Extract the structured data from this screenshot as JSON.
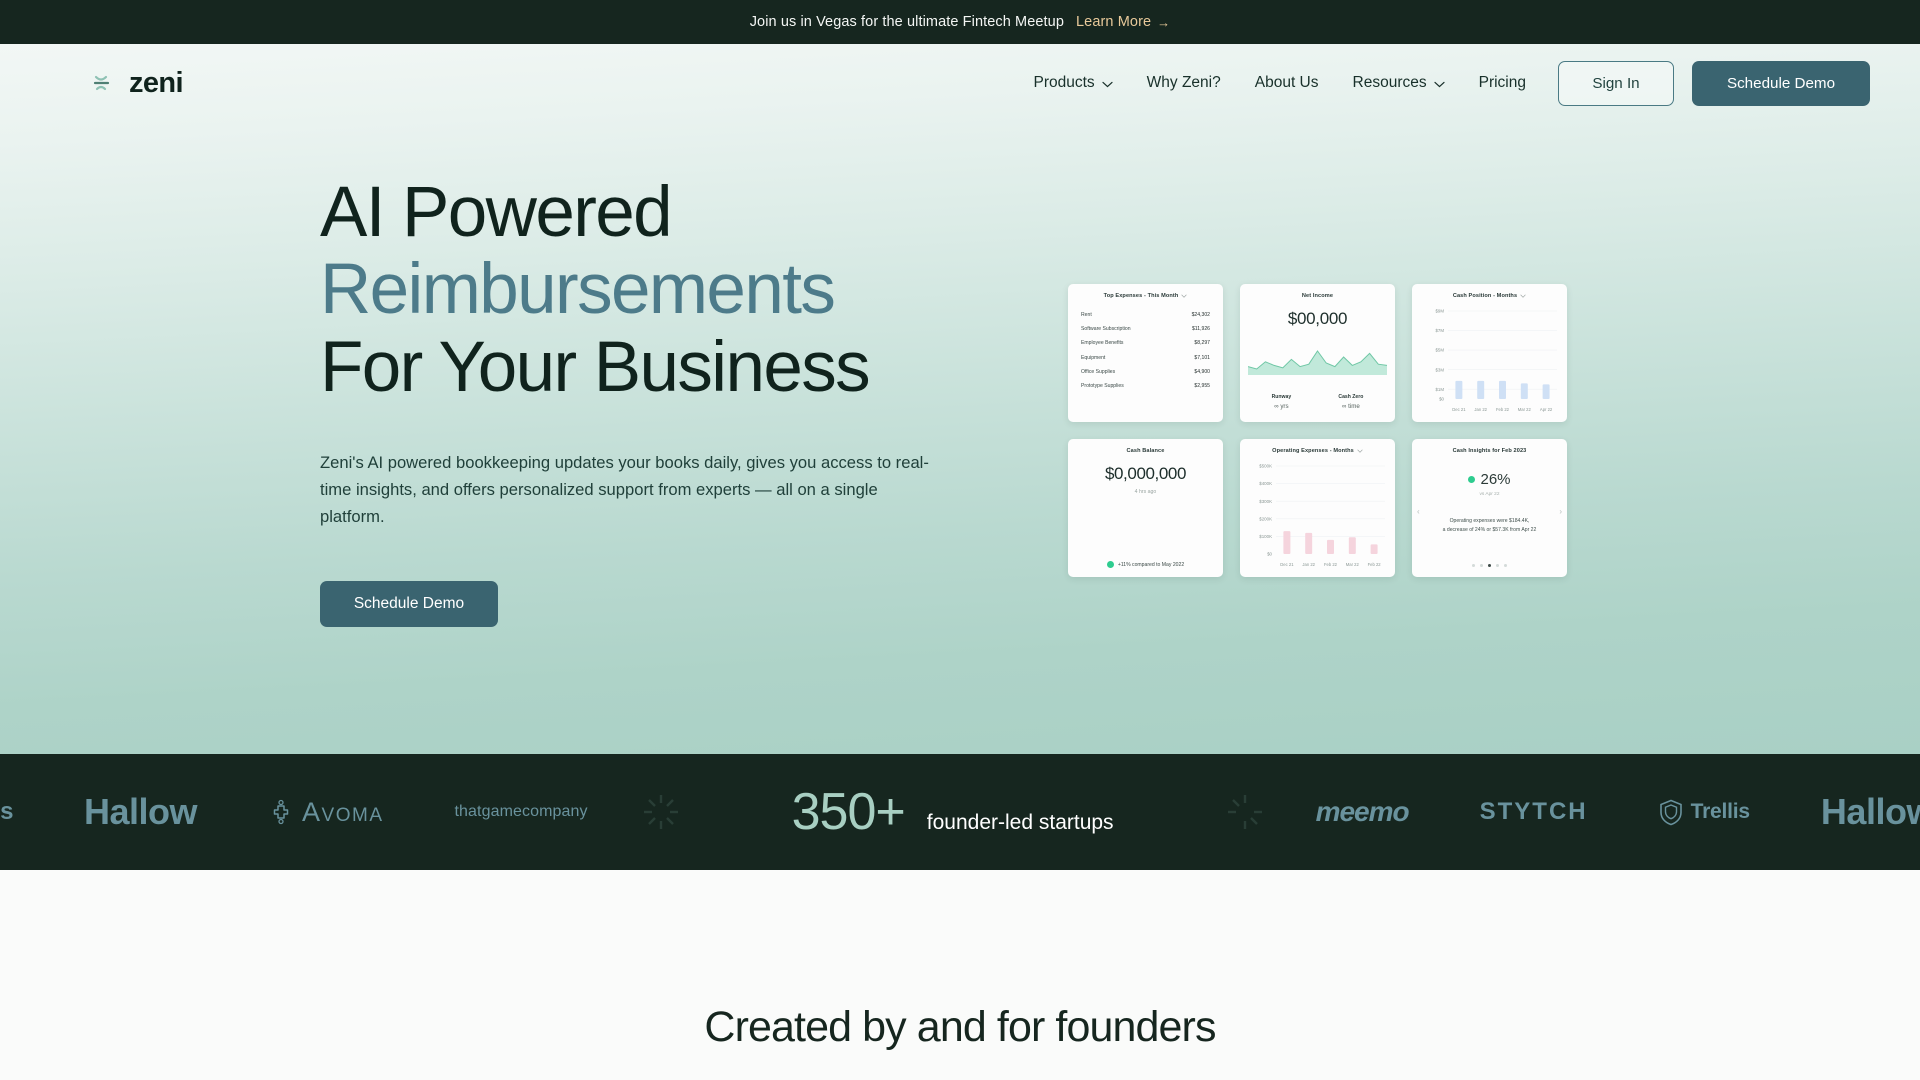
{
  "announcement": {
    "text": "Join us in Vegas for the ultimate Fintech Meetup",
    "link_label": "Learn More",
    "arrow": "→"
  },
  "nav": {
    "logo_text": "zeni",
    "links": [
      {
        "label": "Products",
        "has_dropdown": true
      },
      {
        "label": "Why Zeni?",
        "has_dropdown": false
      },
      {
        "label": "About Us",
        "has_dropdown": false
      },
      {
        "label": "Resources",
        "has_dropdown": true
      },
      {
        "label": "Pricing",
        "has_dropdown": false
      }
    ],
    "sign_in_label": "Sign In",
    "schedule_demo_label": "Schedule Demo"
  },
  "hero": {
    "title_line1": "AI Powered",
    "title_line2": "Reimbursements",
    "title_line3": "For Your Business",
    "accent_color": "#4d7b8a",
    "subtitle": "Zeni's AI powered bookkeeping updates your books daily, gives you access to real-time insights, and offers personalized support from experts — all on a single platform.",
    "cta_label": "Schedule Demo"
  },
  "dashboard": {
    "top_expenses": {
      "title": "Top Expenses - This Month",
      "rows": [
        {
          "label": "Rent",
          "amount": "$24,302"
        },
        {
          "label": "Software Subscription",
          "amount": "$11,926"
        },
        {
          "label": "Employee Benefits",
          "amount": "$8,297"
        },
        {
          "label": "Equipment",
          "amount": "$7,101"
        },
        {
          "label": "Office Supplies",
          "amount": "$4,900"
        },
        {
          "label": "Prototype Supplies",
          "amount": "$2,955"
        }
      ]
    },
    "net_income": {
      "title": "Net Income",
      "value": "$00,000",
      "runway_label": "Runway",
      "runway_value": "∞ yrs",
      "cashzero_label": "Cash Zero",
      "cashzero_value": "∞ time"
    },
    "cash_position": {
      "title": "Cash Position - Months"
    },
    "cash_balance": {
      "title": "Cash Balance",
      "value": "$0,000,000",
      "timestamp": "4 hrs ago",
      "delta": "+11% compared to May 2022"
    },
    "operating_expenses": {
      "title": "Operating Expenses - Months"
    },
    "cash_insights": {
      "title": "Cash Insights for Feb 2023",
      "percent": "26%",
      "compare": "vs Apr 22",
      "body_line1": "Operating expenses were $184.4K,",
      "body_line2": "a decrease of 24% or $57.3K from Apr 22"
    }
  },
  "chart_data": [
    {
      "type": "bar",
      "title": "Cash Position - Months",
      "categories": [
        "Dec 21",
        "Jan 22",
        "Feb 22",
        "Mar 22",
        "Apr 22"
      ],
      "values": [
        1.85,
        1.85,
        1.85,
        1.6,
        1.5
      ],
      "ylabel": "",
      "xlabel": "",
      "ylim": [
        0,
        9
      ],
      "yticks": [
        "$0",
        "$1M",
        "$3M",
        "$5M",
        "$7M",
        "$9M"
      ],
      "ytickvalues": [
        0,
        1,
        3,
        5,
        7,
        9
      ],
      "grid": true,
      "legend": "none",
      "bar_color": "#cfe0f5"
    },
    {
      "type": "bar",
      "title": "Operating Expenses - Months",
      "categories": [
        "Dec 21",
        "Jan 22",
        "Feb 22",
        "Mar 22",
        "Feb 22"
      ],
      "values": [
        130,
        120,
        80,
        95,
        55
      ],
      "ylabel": "",
      "xlabel": "",
      "ylim": [
        0,
        500
      ],
      "yticks": [
        "$0",
        "$100K",
        "$200K",
        "$300K",
        "$400K",
        "$500K"
      ],
      "ytickvalues": [
        0,
        100,
        200,
        300,
        400,
        500
      ],
      "grid": true,
      "legend": "none",
      "bar_color": "#f5d4dd"
    },
    {
      "type": "area",
      "title": "Net Income",
      "x": [
        0,
        1,
        2,
        3,
        4,
        5,
        6,
        7,
        8,
        9,
        10,
        11,
        12,
        13,
        14,
        15,
        16
      ],
      "values": [
        22,
        18,
        30,
        24,
        20,
        34,
        22,
        26,
        48,
        28,
        22,
        38,
        24,
        30,
        44,
        26,
        24
      ],
      "ylabel": "",
      "xlabel": "",
      "grid": false,
      "legend": "none",
      "series_color": "#b6e5d3"
    }
  ],
  "logostrip": {
    "left_brands": [
      "is",
      "Hallow",
      "Avoma",
      "thatgamecompany"
    ],
    "stat_number": "350+",
    "stat_label": "founder-led startups",
    "right_brands": [
      "meemo",
      "STYTCH",
      "Trellis",
      "Hallow"
    ]
  },
  "bottom_section": {
    "heading": "Created by and for founders"
  }
}
